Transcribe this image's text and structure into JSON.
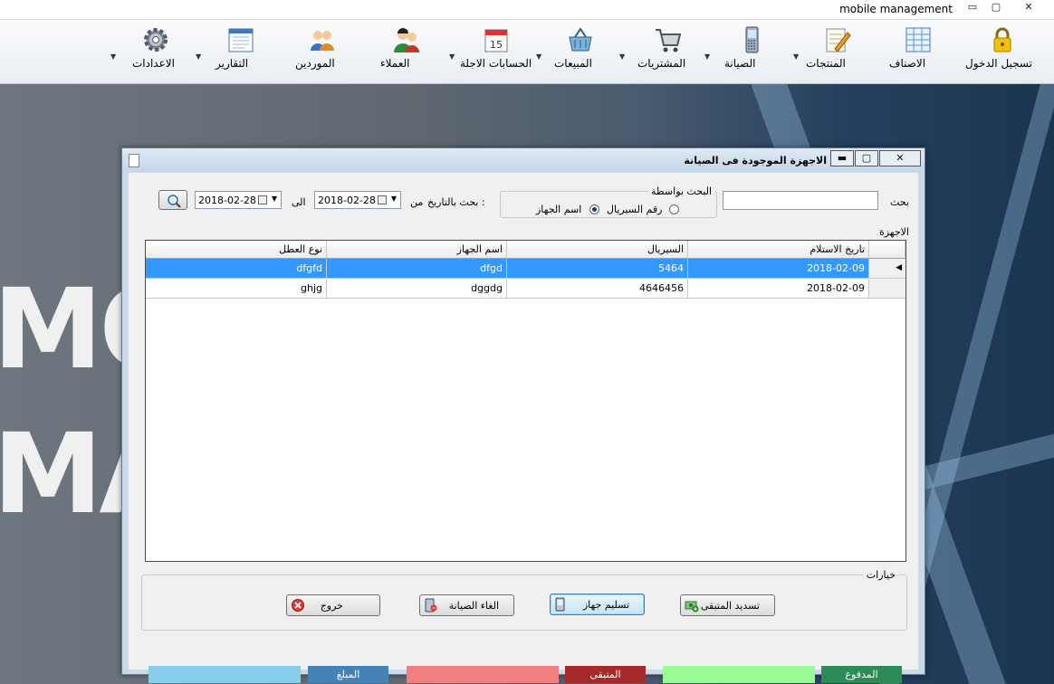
{
  "app": {
    "title": "mobile management",
    "win_min": "▭",
    "win_max": "▢",
    "win_close": "✕"
  },
  "menu": [
    {
      "name": "login",
      "label": "تسجيل الدخول",
      "icon": "lock-icon"
    },
    {
      "name": "categories",
      "label": "الاصناف",
      "icon": "grid-sheet-icon"
    },
    {
      "name": "products",
      "label": "المنتجات",
      "icon": "notepad-pencil-icon"
    },
    {
      "name": "maintenance",
      "label": "الصيانة",
      "icon": "mobile-phone-icon"
    },
    {
      "name": "purchases",
      "label": "المشتريات",
      "icon": "shopping-cart-icon"
    },
    {
      "name": "sales",
      "label": "المبيعات",
      "icon": "basket-icon"
    },
    {
      "name": "deferred-accounts",
      "label": "الحسابات الاجلة",
      "icon": "calendar-icon"
    },
    {
      "name": "customers",
      "label": "العملاء",
      "icon": "customers-icon"
    },
    {
      "name": "suppliers",
      "label": "الموردين",
      "icon": "suppliers-icon"
    },
    {
      "name": "reports",
      "label": "التقارير",
      "icon": "report-icon"
    },
    {
      "name": "settings",
      "label": "الاعدادات",
      "icon": "gear-icon"
    }
  ],
  "background_text": {
    "line1": "MOBI",
    "line2": "MA"
  },
  "dialog": {
    "title": "الاجهزة الموجودة فى الصيانة",
    "ctl_min": "▬",
    "ctl_max": "▢",
    "ctl_close": "✕",
    "search_label": "بحث",
    "search_value": "",
    "search_by_group": "البحث بواسطة",
    "radio_serial": "رقم السيريال",
    "radio_name": "اسم الجهاز",
    "radio_selected": "name",
    "date_search_label": "بحث بالتاريخ :",
    "from_label": "من",
    "to_label": "الى",
    "date_from": "2018-02-28",
    "date_to": "2018-02-28",
    "devices_group": "الاجهزة",
    "options_group": "خيارات"
  },
  "table": {
    "columns": [
      "تاريخ الاستلام",
      "السيريال",
      "اسم الجهاز",
      "نوع العطل"
    ],
    "rows": [
      {
        "date": "2018-02-09",
        "serial": "5464",
        "device": "dfgd",
        "fault": "dfgfd",
        "selected": true
      },
      {
        "date": "2018-02-09",
        "serial": "4646456",
        "device": "dggdg",
        "fault": "ghjg",
        "selected": false
      }
    ]
  },
  "buttons": {
    "pay_remaining": "تسديد المتبقى",
    "deliver": "تسليم جهاز",
    "cancel_maintenance": "الغاء الصيانة",
    "exit": "خروج"
  },
  "summary": {
    "paid_label": "المدفوع",
    "paid_value": "",
    "remaining_label": "المتبقى",
    "remaining_value": "",
    "amount_label": "المبلغ",
    "amount_value": ""
  },
  "colors": {
    "paid_label_bg": "#2e8b57",
    "paid_value_bg": "#98fb98",
    "remaining_label_bg": "#a52a2a",
    "remaining_value_bg": "#f08080",
    "amount_label_bg": "#4682b4",
    "amount_value_bg": "#87ceeb",
    "selection": "#3399ff"
  }
}
